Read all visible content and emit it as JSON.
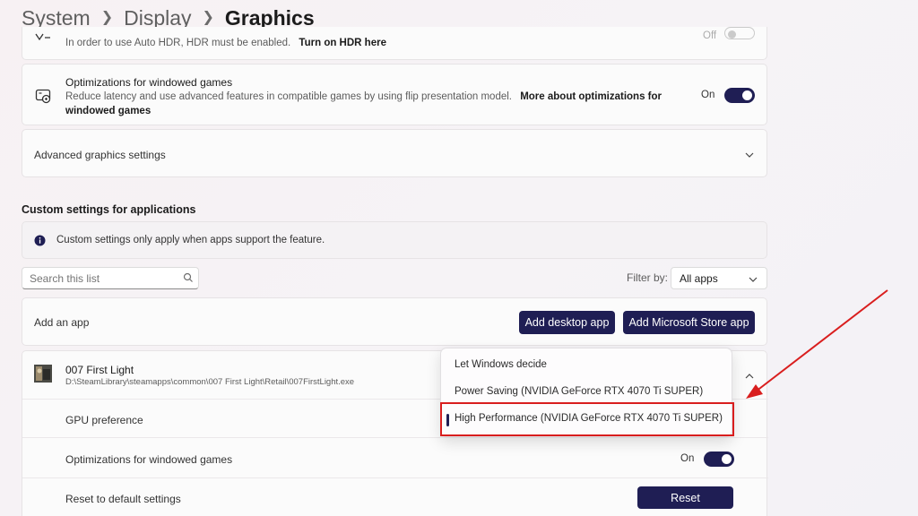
{
  "breadcrumb": {
    "level1": "System",
    "level2": "Display",
    "current": "Graphics"
  },
  "auto_hdr": {
    "note": "In order to use Auto HDR, HDR must be enabled.",
    "link": "Turn on HDR here",
    "toggle_state": "Off"
  },
  "windowed_opt": {
    "title": "Optimizations for windowed games",
    "description": "Reduce latency and use advanced features in compatible games by using flip presentation model.",
    "link_part1": "More about optimizations for",
    "link_part2": "windowed games",
    "state": "On"
  },
  "advanced": {
    "label": "Advanced graphics settings"
  },
  "custom_section": {
    "title": "Custom settings for applications",
    "info": "Custom settings only apply when apps support the feature."
  },
  "search": {
    "placeholder": "Search this list"
  },
  "filter": {
    "label": "Filter by:",
    "value": "All apps"
  },
  "add_app": {
    "label": "Add an app",
    "desktop_button": "Add desktop app",
    "store_button": "Add Microsoft Store app"
  },
  "app": {
    "name": "007 First Light",
    "path": "D:\\SteamLibrary\\steamapps\\common\\007 First Light\\Retail\\007FirstLight.exe",
    "gpu_pref_label": "GPU preference",
    "windowed_label": "Optimizations for windowed games",
    "windowed_state": "On",
    "reset_label": "Reset to default settings",
    "reset_button": "Reset"
  },
  "dropdown": {
    "options": [
      "Let Windows decide",
      "Power Saving (NVIDIA GeForce RTX 4070 Ti SUPER)",
      "High Performance (NVIDIA GeForce RTX 4070 Ti SUPER)"
    ],
    "selected_index": 2
  },
  "colors": {
    "accent": "#1f1e54",
    "annotation": "#d91e1e"
  }
}
